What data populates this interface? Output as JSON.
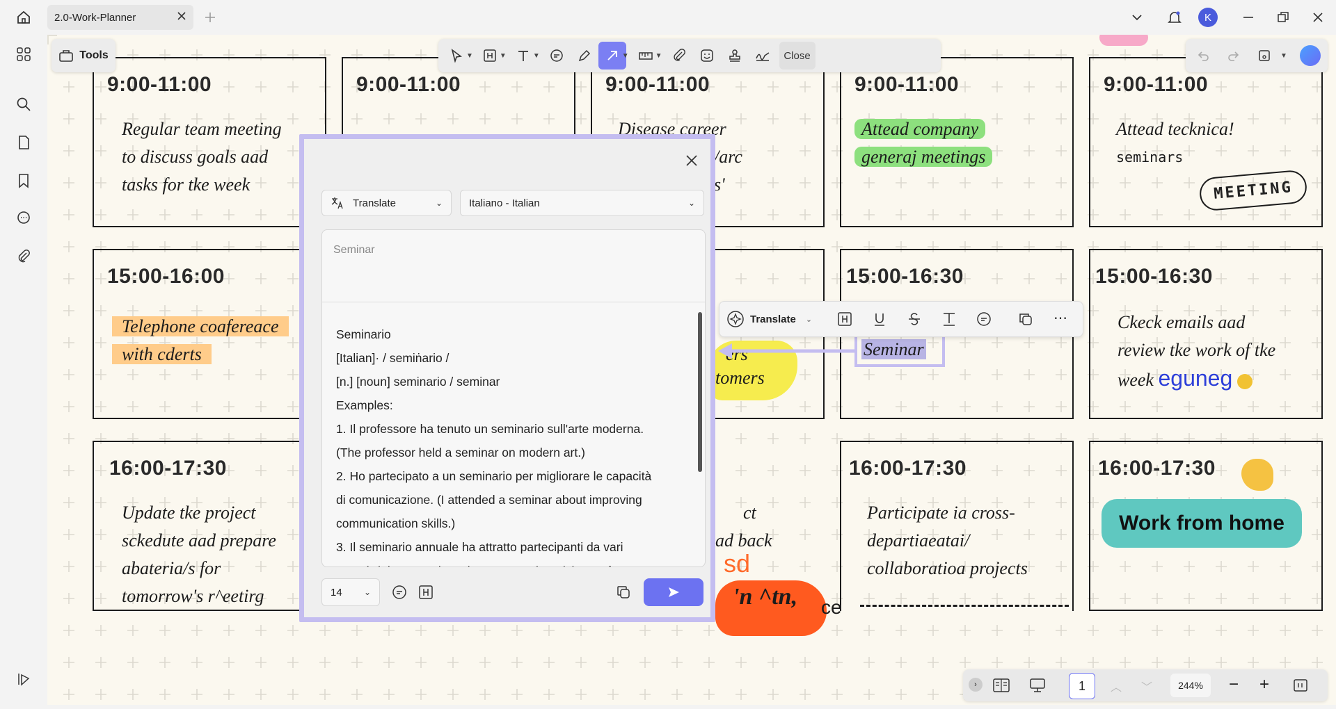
{
  "app": {
    "tab_title": "2.0-Work-Planner",
    "avatar_initial": "K",
    "accent": "#7b7ff3"
  },
  "toolbar": {
    "tools_label": "Tools",
    "close_label": "Close"
  },
  "planner": {
    "rows": [
      {
        "cells": [
          {
            "time": "9:00-11:00",
            "lines": [
              "Regular team meeting",
              "to discuss goals aad",
              "tasks for tke week"
            ]
          },
          {
            "time": "9:00-11:00",
            "lines": []
          },
          {
            "time": "9:00-11:00",
            "lines": [
              "Disease career",
              "/arc",
              "s'"
            ]
          },
          {
            "time": "9:00-11:00",
            "lines": [
              "Attead company",
              "generaj meetings"
            ]
          },
          {
            "time": "9:00-11:00",
            "lines": [
              "Attead tecknica!",
              "seminars"
            ],
            "stamp": "MEETING"
          }
        ]
      },
      {
        "cells": [
          {
            "time": "15:00-16:00",
            "lines": [
              "Telephone coafereace",
              "with cderts"
            ]
          },
          {
            "time": "",
            "lines": [
              "ers",
              "tomers"
            ]
          },
          {
            "time": "15:00-16:30",
            "lines": [
              "Seminar"
            ]
          },
          {
            "time": "15:00-16:30",
            "lines": [
              "Ckeck emails aad",
              "review tke work of tke",
              "week"
            ],
            "scribble": "eguneg"
          }
        ]
      },
      {
        "cells": [
          {
            "time": "16:00-17:30",
            "lines": [
              "Update tke project",
              "sckedute aad prepare",
              "abateria/s for",
              "tomorrow's r^eetirg"
            ]
          },
          {
            "time": "",
            "lines": [
              "ct",
              "ad back"
            ],
            "splash": [
              "sd",
              "'n ^tn,",
              "ce"
            ]
          },
          {
            "time": "16:00-17:30",
            "lines": [
              "Participate ia cross-",
              "departiaeatai/",
              "collaboratioa projects"
            ]
          },
          {
            "time": "16:00-17:30",
            "badge": "Work from home"
          }
        ]
      }
    ]
  },
  "translate_panel": {
    "mode": "Translate",
    "language": "Italiano - Italian",
    "source_text": "Seminar",
    "result_lines": [
      "Seminario",
      "[Italian]· / semiṅario /",
      "[n.] [noun] seminario / seminar",
      "Examples:",
      "1. Il professore ha tenuto un seminario sull'arte moderna.",
      "(The professor held a seminar on modern art.)",
      "2. Ho partecipato a un seminario per migliorare le capacità",
      "di comunicazione. (I attended a seminar about improving",
      "communication skills.)",
      "3. Il seminario annuale ha attratto partecipanti da vari",
      "settori. (The annual seminar attracted participants from"
    ],
    "font_size": "14"
  },
  "float_toolbar": {
    "translate_label": "Translate"
  },
  "bottom_bar": {
    "page": "1",
    "zoom": "244%"
  }
}
